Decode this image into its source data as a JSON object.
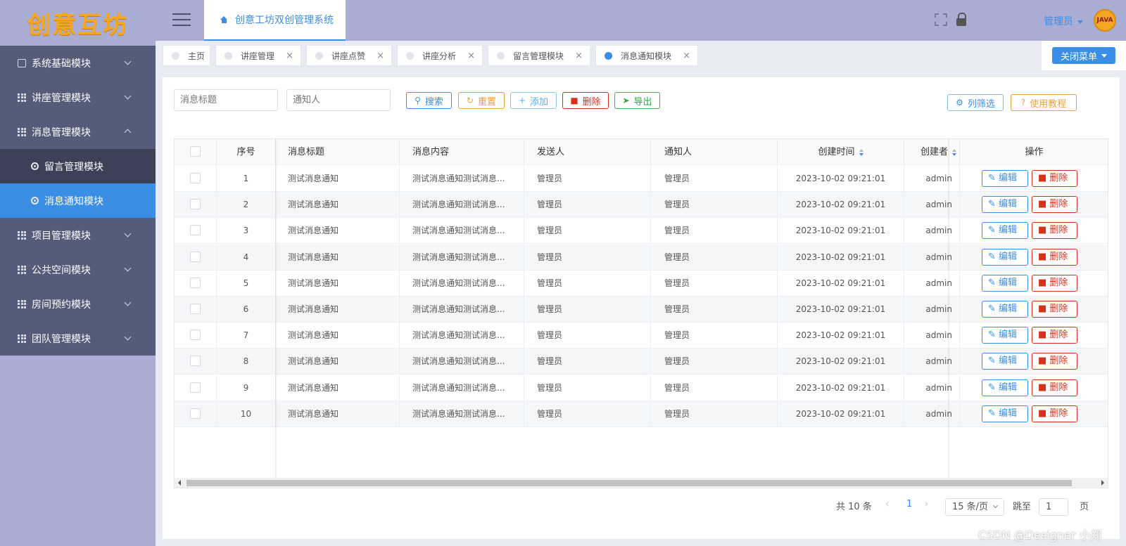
{
  "logo": {
    "text": "创意互坊"
  },
  "sidebar": {
    "items": [
      {
        "label": "系统基础模块",
        "icon": "chart-icon",
        "expanded": false
      },
      {
        "label": "讲座管理模块",
        "icon": "grid-icon",
        "expanded": false
      },
      {
        "label": "消息管理模块",
        "icon": "grid-icon",
        "expanded": true
      },
      {
        "label": "项目管理模块",
        "icon": "grid-icon",
        "expanded": false
      },
      {
        "label": "公共空间模块",
        "icon": "grid-icon",
        "expanded": false
      },
      {
        "label": "房间预约模块",
        "icon": "grid-icon",
        "expanded": false
      },
      {
        "label": "团队管理模块",
        "icon": "grid-icon",
        "expanded": false
      }
    ],
    "submenu": [
      {
        "label": "留言管理模块",
        "active": false
      },
      {
        "label": "消息通知模块",
        "active": true
      }
    ]
  },
  "header": {
    "home_tab": "创意工坊双创管理系统",
    "user": "管理员",
    "avatar_text": "JAVA"
  },
  "tags": [
    {
      "label": "主页",
      "closable": false,
      "active": false
    },
    {
      "label": "讲座管理",
      "closable": true,
      "active": false
    },
    {
      "label": "讲座点赞",
      "closable": true,
      "active": false
    },
    {
      "label": "讲座分析",
      "closable": true,
      "active": false
    },
    {
      "label": "留言管理模块",
      "closable": true,
      "active": false
    },
    {
      "label": "消息通知模块",
      "closable": true,
      "active": true
    }
  ],
  "close_menu_label": "关闭菜单",
  "toolbar": {
    "title_placeholder": "消息标题",
    "notify_placeholder": "通知人",
    "search": "搜索",
    "reset": "重置",
    "add": "添加",
    "delete": "删除",
    "export": "导出",
    "column_filter": "列筛选",
    "tutorial": "使用教程"
  },
  "table": {
    "columns": [
      "序号",
      "消息标题",
      "消息内容",
      "发送人",
      "通知人",
      "创建时间",
      "创建者",
      "操作"
    ],
    "rows": [
      {
        "no": "1",
        "title": "测试消息通知",
        "content": "测试消息通知测试消息...",
        "sender": "管理员",
        "notify": "管理员",
        "time": "2023-10-02 09:21:01",
        "creator": "admin"
      },
      {
        "no": "2",
        "title": "测试消息通知",
        "content": "测试消息通知测试消息...",
        "sender": "管理员",
        "notify": "管理员",
        "time": "2023-10-02 09:21:01",
        "creator": "admin"
      },
      {
        "no": "3",
        "title": "测试消息通知",
        "content": "测试消息通知测试消息...",
        "sender": "管理员",
        "notify": "管理员",
        "time": "2023-10-02 09:21:01",
        "creator": "admin"
      },
      {
        "no": "4",
        "title": "测试消息通知",
        "content": "测试消息通知测试消息...",
        "sender": "管理员",
        "notify": "管理员",
        "time": "2023-10-02 09:21:01",
        "creator": "admin"
      },
      {
        "no": "5",
        "title": "测试消息通知",
        "content": "测试消息通知测试消息...",
        "sender": "管理员",
        "notify": "管理员",
        "time": "2023-10-02 09:21:01",
        "creator": "admin"
      },
      {
        "no": "6",
        "title": "测试消息通知",
        "content": "测试消息通知测试消息...",
        "sender": "管理员",
        "notify": "管理员",
        "time": "2023-10-02 09:21:01",
        "creator": "admin"
      },
      {
        "no": "7",
        "title": "测试消息通知",
        "content": "测试消息通知测试消息...",
        "sender": "管理员",
        "notify": "管理员",
        "time": "2023-10-02 09:21:01",
        "creator": "admin"
      },
      {
        "no": "8",
        "title": "测试消息通知",
        "content": "测试消息通知测试消息...",
        "sender": "管理员",
        "notify": "管理员",
        "time": "2023-10-02 09:21:01",
        "creator": "admin"
      },
      {
        "no": "9",
        "title": "测试消息通知",
        "content": "测试消息通知测试消息...",
        "sender": "管理员",
        "notify": "管理员",
        "time": "2023-10-02 09:21:01",
        "creator": "admin"
      },
      {
        "no": "10",
        "title": "测试消息通知",
        "content": "测试消息通知测试消息...",
        "sender": "管理员",
        "notify": "管理员",
        "time": "2023-10-02 09:21:01",
        "creator": "admin"
      }
    ],
    "edit_label": "编辑",
    "delete_label": "删除"
  },
  "pagination": {
    "total": "共 10 条",
    "current_page": "1",
    "page_size": "15 条/页",
    "jump_label": "跳至",
    "jump_value": "1",
    "page_suffix": "页"
  },
  "watermark": "CSDN @Designer 小郑",
  "colors": {
    "accent": "#3a8ee6",
    "danger": "#d9301b",
    "warning": "#e6a23c",
    "success": "#28a745",
    "sidebar_bg": "#545c79",
    "header_bg": "#a9acd3"
  }
}
